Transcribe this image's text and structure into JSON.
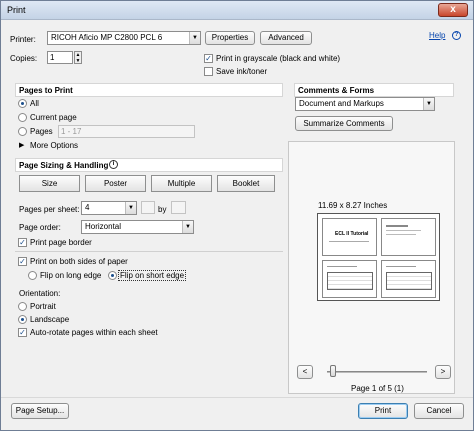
{
  "window": {
    "title": "Print",
    "close_label": "x"
  },
  "printer": {
    "label": "Printer:",
    "selected": "RICOH Aficio MP C2800 PCL 6",
    "properties_label": "Properties",
    "advanced_label": "Advanced",
    "help_label": "Help"
  },
  "copies": {
    "label": "Copies:",
    "value": "1"
  },
  "grayscale": {
    "label": "Print in grayscale (black and white)",
    "checked": true
  },
  "save_ink": {
    "label": "Save ink/toner",
    "checked": false
  },
  "pages_to_print": {
    "header": "Pages to Print",
    "all_label": "All",
    "current_label": "Current page",
    "pages_label": "Pages",
    "pages_value": "1 - 17",
    "more_label": "More Options"
  },
  "comments": {
    "header": "Comments & Forms",
    "selected": "Document and Markups",
    "summarize_label": "Summarize Comments"
  },
  "sizing": {
    "header": "Page Sizing & Handling",
    "info_icon": "i",
    "tabs": [
      "Size",
      "Poster",
      "Multiple",
      "Booklet"
    ],
    "pages_per_sheet_label": "Pages per sheet:",
    "pages_per_sheet_value": "4",
    "by_label": "by",
    "page_order_label": "Page order:",
    "page_order_value": "Horizontal",
    "border_label": "Print page border",
    "both_sides_label": "Print on both sides of paper",
    "long_edge_label": "Flip on long edge",
    "short_edge_label": "Flip on short edge"
  },
  "orientation": {
    "label": "Orientation:",
    "portrait_label": "Portrait",
    "landscape_label": "Landscape",
    "autorotate_label": "Auto-rotate pages within each sheet"
  },
  "preview": {
    "size_text": "11.69 x 8.27 Inches",
    "page_title": "ECL II Tutorial",
    "page_indicator": "Page 1 of 5 (1)",
    "prev_label": "<",
    "next_label": ">"
  },
  "footer": {
    "page_setup_label": "Page Setup...",
    "print_label": "Print",
    "cancel_label": "Cancel"
  }
}
